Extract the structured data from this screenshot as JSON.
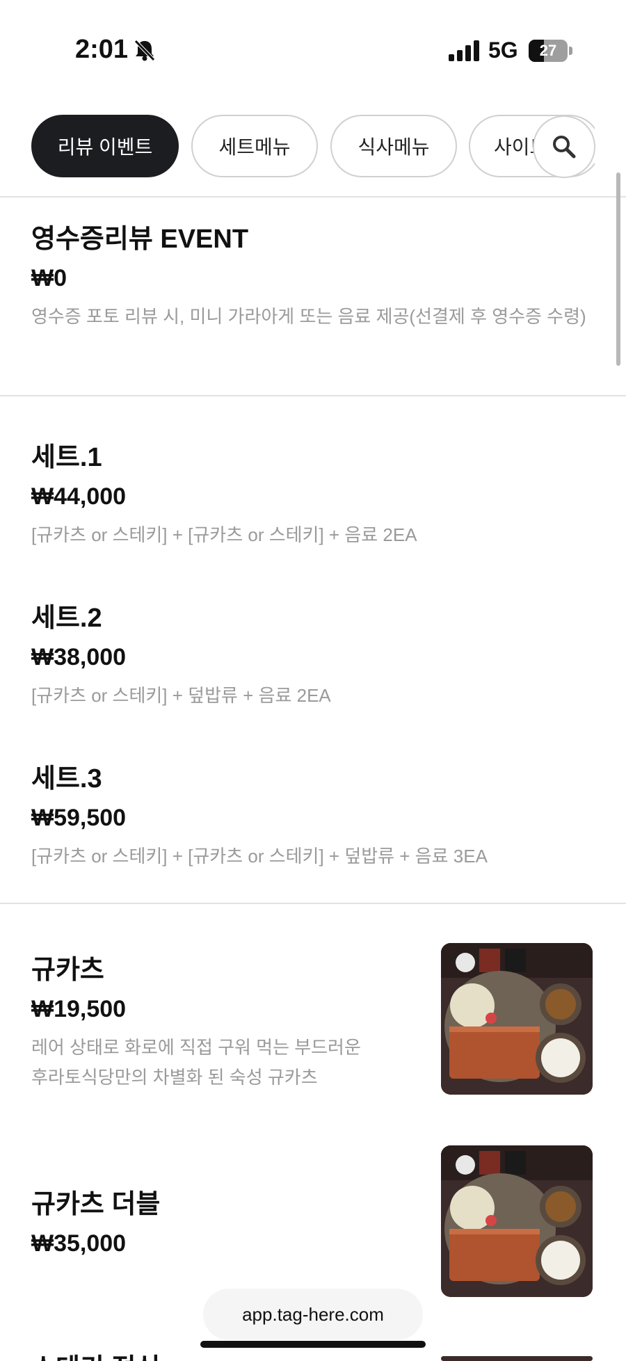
{
  "status_bar": {
    "time": "2:01",
    "network": "5G",
    "battery": "27",
    "icons": [
      "bell-muted-icon",
      "signal-icon",
      "battery-icon"
    ]
  },
  "tabs": [
    {
      "label": "리뷰 이벤트",
      "active": true
    },
    {
      "label": "세트메뉴",
      "active": false
    },
    {
      "label": "식사메뉴",
      "active": false
    },
    {
      "label": "사이드메뉴",
      "active": false
    }
  ],
  "search": {
    "icon": "search-icon"
  },
  "menu": {
    "event": {
      "name": "영수증리뷰 EVENT",
      "price": "₩0",
      "desc": "영수증 포토 리뷰 시, 미니 가라아게 또는 음료 제공(선결제 후 영수증 수령)"
    },
    "set1": {
      "name": "세트.1",
      "price": "₩44,000",
      "desc": "[규카츠 or 스테키] + [규카츠 or 스테키] + 음료 2EA"
    },
    "set2": {
      "name": "세트.2",
      "price": "₩38,000",
      "desc": "[규카츠 or 스테키] + 덮밥류 + 음료 2EA"
    },
    "set3": {
      "name": "세트.3",
      "price": "₩59,500",
      "desc": "[규카츠 or 스테키] + [규카츠 or 스테키] + 덮밥류 + 음료 3EA"
    },
    "gyukatsu": {
      "name": "규카츠",
      "price": "₩19,500",
      "desc_line1": "레어 상태로 화로에 직접 구워 먹는 부드러운",
      "desc_line2": "후라토식당만의 차별화 된 숙성 규카츠"
    },
    "gyukatsu_double": {
      "name": "규카츠 더블",
      "price": "₩35,000"
    },
    "next_partial": {
      "name": "스테키 정식"
    }
  },
  "browser": {
    "url": "app.tag-here.com"
  },
  "colors": {
    "active_tab_bg": "#1c1d21",
    "desc_text": "#9a9a9a",
    "divider": "#e2e2e2"
  }
}
